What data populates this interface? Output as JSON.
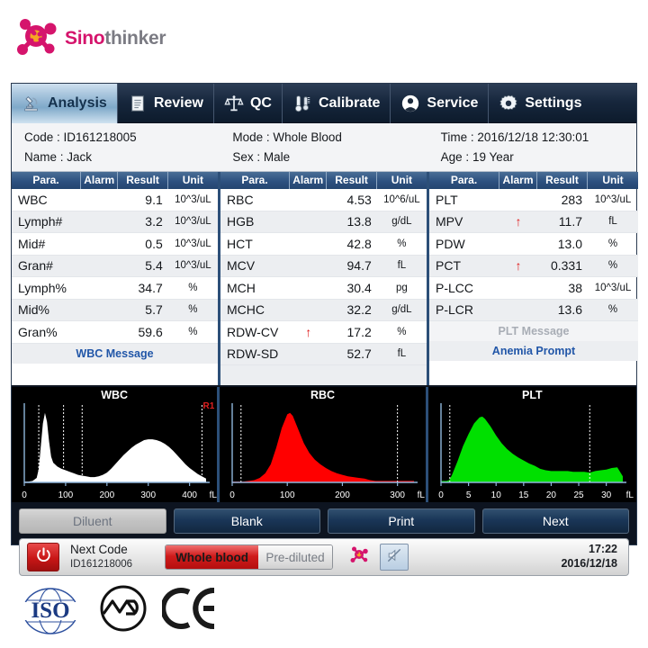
{
  "brand": {
    "name_part1": "Sino",
    "name_part2": "thinker",
    "logo_icon": "molecule-icon",
    "colors": {
      "accent": "#d5146c",
      "accent2": "#7b7b83",
      "core": "#f5a623"
    }
  },
  "tabs": [
    {
      "label": "Analysis",
      "icon": "microscope-icon",
      "active": true
    },
    {
      "label": "Review",
      "icon": "document-icon",
      "active": false
    },
    {
      "label": "QC",
      "icon": "balance-icon",
      "active": false
    },
    {
      "label": "Calibrate",
      "icon": "thermometer-icon",
      "active": false
    },
    {
      "label": "Service",
      "icon": "person-icon",
      "active": false
    },
    {
      "label": "Settings",
      "icon": "gear-icon",
      "active": false
    }
  ],
  "info": {
    "code_label": "Code : ",
    "code_value": "ID161218005",
    "mode_label": "Mode : ",
    "mode_value": "Whole Blood",
    "time_label": "Time : ",
    "time_value": "2016/12/18 12:30:01",
    "name_label": "Name : ",
    "name_value": "Jack",
    "sex_label": "Sex : ",
    "sex_value": "Male",
    "age_label": "Age : ",
    "age_value": "19 Year"
  },
  "table": {
    "headers": [
      "Para.",
      "Alarm",
      "Result",
      "Unit"
    ],
    "alarm_high_glyph": "↑",
    "alarm_color": "#e01b1b",
    "columns": [
      {
        "rows": [
          {
            "para": "WBC",
            "alarm": "",
            "result": "9.1",
            "unit": "10^3/uL"
          },
          {
            "para": "Lymph#",
            "alarm": "",
            "result": "3.2",
            "unit": "10^3/uL"
          },
          {
            "para": "Mid#",
            "alarm": "",
            "result": "0.5",
            "unit": "10^3/uL"
          },
          {
            "para": "Gran#",
            "alarm": "",
            "result": "5.4",
            "unit": "10^3/uL"
          },
          {
            "para": "Lymph%",
            "alarm": "",
            "result": "34.7",
            "unit": "%"
          },
          {
            "para": "Mid%",
            "alarm": "",
            "result": "5.7",
            "unit": "%"
          },
          {
            "para": "Gran%",
            "alarm": "",
            "result": "59.6",
            "unit": "%"
          }
        ],
        "message": "WBC Message",
        "message_style": "blue"
      },
      {
        "rows": [
          {
            "para": "RBC",
            "alarm": "",
            "result": "4.53",
            "unit": "10^6/uL"
          },
          {
            "para": "HGB",
            "alarm": "",
            "result": "13.8",
            "unit": "g/dL"
          },
          {
            "para": "HCT",
            "alarm": "",
            "result": "42.8",
            "unit": "%"
          },
          {
            "para": "MCV",
            "alarm": "",
            "result": "94.7",
            "unit": "fL"
          },
          {
            "para": "MCH",
            "alarm": "",
            "result": "30.4",
            "unit": "pg"
          },
          {
            "para": "MCHC",
            "alarm": "",
            "result": "32.2",
            "unit": "g/dL"
          },
          {
            "para": "RDW-CV",
            "alarm": "H",
            "result": "17.2",
            "unit": "%"
          },
          {
            "para": "RDW-SD",
            "alarm": "",
            "result": "52.7",
            "unit": "fL"
          }
        ],
        "message": "",
        "message_style": "plain"
      },
      {
        "rows": [
          {
            "para": "PLT",
            "alarm": "",
            "result": "283",
            "unit": "10^3/uL"
          },
          {
            "para": "MPV",
            "alarm": "H",
            "result": "11.7",
            "unit": "fL"
          },
          {
            "para": "PDW",
            "alarm": "",
            "result": "13.0",
            "unit": "%"
          },
          {
            "para": "PCT",
            "alarm": "H",
            "result": "0.331",
            "unit": "%"
          },
          {
            "para": "P-LCC",
            "alarm": "",
            "result": "38",
            "unit": "10^3/uL"
          },
          {
            "para": "P-LCR",
            "alarm": "",
            "result": "13.6",
            "unit": "%"
          }
        ],
        "message": "PLT Message",
        "message_style": "gray",
        "message2": "Anemia Prompt",
        "message2_style": "blue"
      }
    ]
  },
  "chart_data": [
    {
      "type": "area",
      "title": "WBC",
      "color": "#ffffff",
      "xlabel": "fL",
      "ticks": [
        0,
        100,
        200,
        300,
        400
      ],
      "xlim": [
        0,
        440
      ],
      "ylim": [
        0,
        100
      ],
      "grid": false,
      "markers": [
        35,
        95,
        140,
        430
      ],
      "annotations": [
        "R1"
      ],
      "x": [
        0,
        10,
        20,
        30,
        35,
        40,
        45,
        50,
        55,
        60,
        65,
        70,
        80,
        90,
        100,
        110,
        120,
        130,
        140,
        150,
        160,
        170,
        180,
        190,
        200,
        210,
        220,
        230,
        240,
        250,
        260,
        270,
        280,
        290,
        300,
        310,
        320,
        330,
        340,
        350,
        360,
        370,
        380,
        390,
        400,
        410,
        420,
        430,
        440
      ],
      "y": [
        1,
        1,
        2,
        6,
        18,
        48,
        78,
        92,
        80,
        54,
        34,
        26,
        21,
        18,
        16,
        14,
        12,
        10,
        9,
        8,
        7,
        7,
        8,
        10,
        13,
        18,
        24,
        30,
        36,
        41,
        46,
        50,
        53,
        56,
        57,
        57,
        56,
        54,
        51,
        47,
        42,
        36,
        30,
        24,
        19,
        15,
        11,
        8,
        5
      ]
    },
    {
      "type": "area",
      "title": "RBC",
      "color": "#ff0000",
      "xlabel": "fL",
      "ticks": [
        0,
        100,
        200,
        300
      ],
      "xlim": [
        0,
        330
      ],
      "ylim": [
        0,
        100
      ],
      "grid": false,
      "markers": [
        16,
        300
      ],
      "annotations": [],
      "x": [
        0,
        10,
        20,
        30,
        40,
        50,
        60,
        70,
        80,
        90,
        100,
        105,
        110,
        120,
        130,
        140,
        150,
        160,
        170,
        180,
        190,
        200,
        210,
        220,
        230,
        240,
        250,
        260,
        280,
        300,
        320,
        330
      ],
      "y": [
        1,
        1,
        1,
        2,
        3,
        6,
        12,
        24,
        46,
        72,
        90,
        92,
        88,
        70,
        52,
        39,
        30,
        24,
        19,
        15,
        12,
        10,
        8,
        7,
        6,
        5,
        3,
        2,
        2,
        2,
        2,
        2
      ]
    },
    {
      "type": "area",
      "title": "PLT",
      "color": "#00e000",
      "xlabel": "fL",
      "ticks": [
        0,
        5,
        10,
        15,
        20,
        25,
        30
      ],
      "xlim": [
        0,
        33
      ],
      "ylim": [
        0,
        100
      ],
      "grid": false,
      "markers": [
        1.6,
        27
      ],
      "annotations": [],
      "x": [
        0,
        1,
        1.5,
        2,
        3,
        4,
        5,
        6,
        7,
        7.5,
        8,
        9,
        10,
        11,
        12,
        13,
        14,
        15,
        16,
        17,
        18,
        19,
        20,
        21,
        22,
        23,
        24,
        25,
        26,
        27,
        28,
        29,
        30,
        31,
        32,
        33
      ],
      "y": [
        2,
        2,
        3,
        10,
        28,
        48,
        64,
        78,
        86,
        87,
        84,
        74,
        62,
        52,
        44,
        38,
        33,
        29,
        25,
        22,
        18,
        16,
        15,
        15,
        15,
        15,
        14,
        14,
        14,
        13,
        15,
        16,
        17,
        19,
        20,
        8
      ]
    }
  ],
  "actions": [
    {
      "label": "Diluent",
      "disabled": true
    },
    {
      "label": "Blank",
      "disabled": false
    },
    {
      "label": "Print",
      "disabled": false
    },
    {
      "label": "Next",
      "disabled": false
    }
  ],
  "status": {
    "power_icon": "power-icon",
    "next_code_label": "Next Code",
    "next_code_value": "ID161218006",
    "mode_toggle": {
      "on_label": "Whole blood",
      "off_label": "Pre-diluted"
    },
    "molecule_icon": "molecule-icon",
    "sound_icon": "sound-muted-icon",
    "clock_time": "17:22",
    "clock_date": "2016/12/18"
  },
  "certs": [
    {
      "name": "iso-logo",
      "text": "ISO"
    },
    {
      "name": "md-logo",
      "text": "MD"
    },
    {
      "name": "ce-logo",
      "text": "CE"
    }
  ]
}
